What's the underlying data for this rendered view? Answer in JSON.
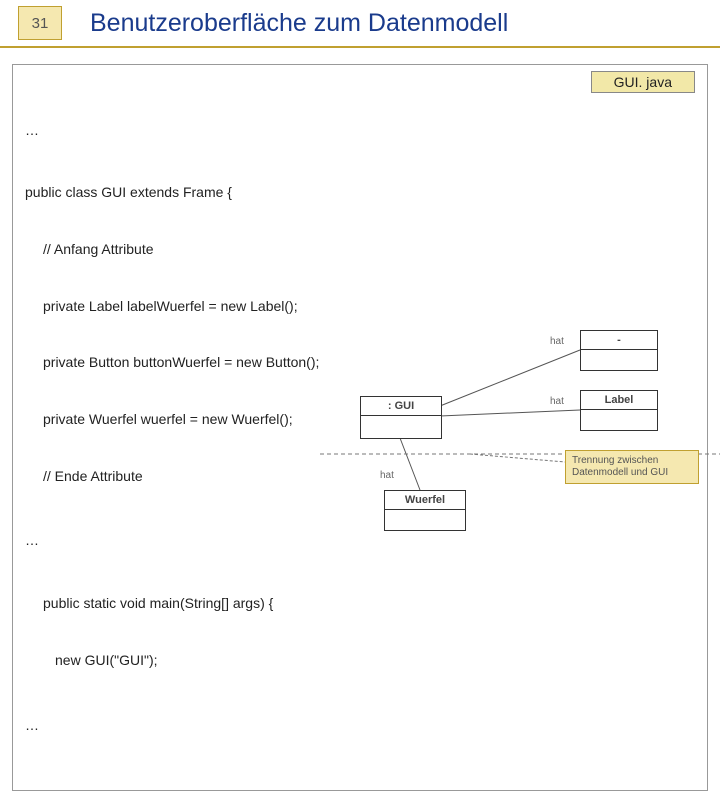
{
  "page_number": "31",
  "title": "Benutzeroberfläche zum Datenmodell",
  "filename": "GUI. java",
  "code": {
    "dots1": "…",
    "class_decl": "public class GUI extends Frame {",
    "comment1": "// Anfang Attribute",
    "line1": "private Label labelWuerfel = new Label();",
    "line2": "private Button buttonWuerfel = new Button();",
    "line3": "private Wuerfel wuerfel = new Wuerfel();",
    "comment2": "// Ende Attribute",
    "dots2": "…",
    "main_decl": "public static void main(String[] args) {",
    "main_body": "new GUI(\"GUI\");",
    "dots3": "…"
  },
  "diagram": {
    "gui": ": GUI",
    "button": "-",
    "label": "Label",
    "wuerfel": "Wuerfel",
    "rel1": "hat",
    "rel2": "hat",
    "rel3": "hat",
    "note": "Trennung zwischen Datenmodell und GUI"
  }
}
